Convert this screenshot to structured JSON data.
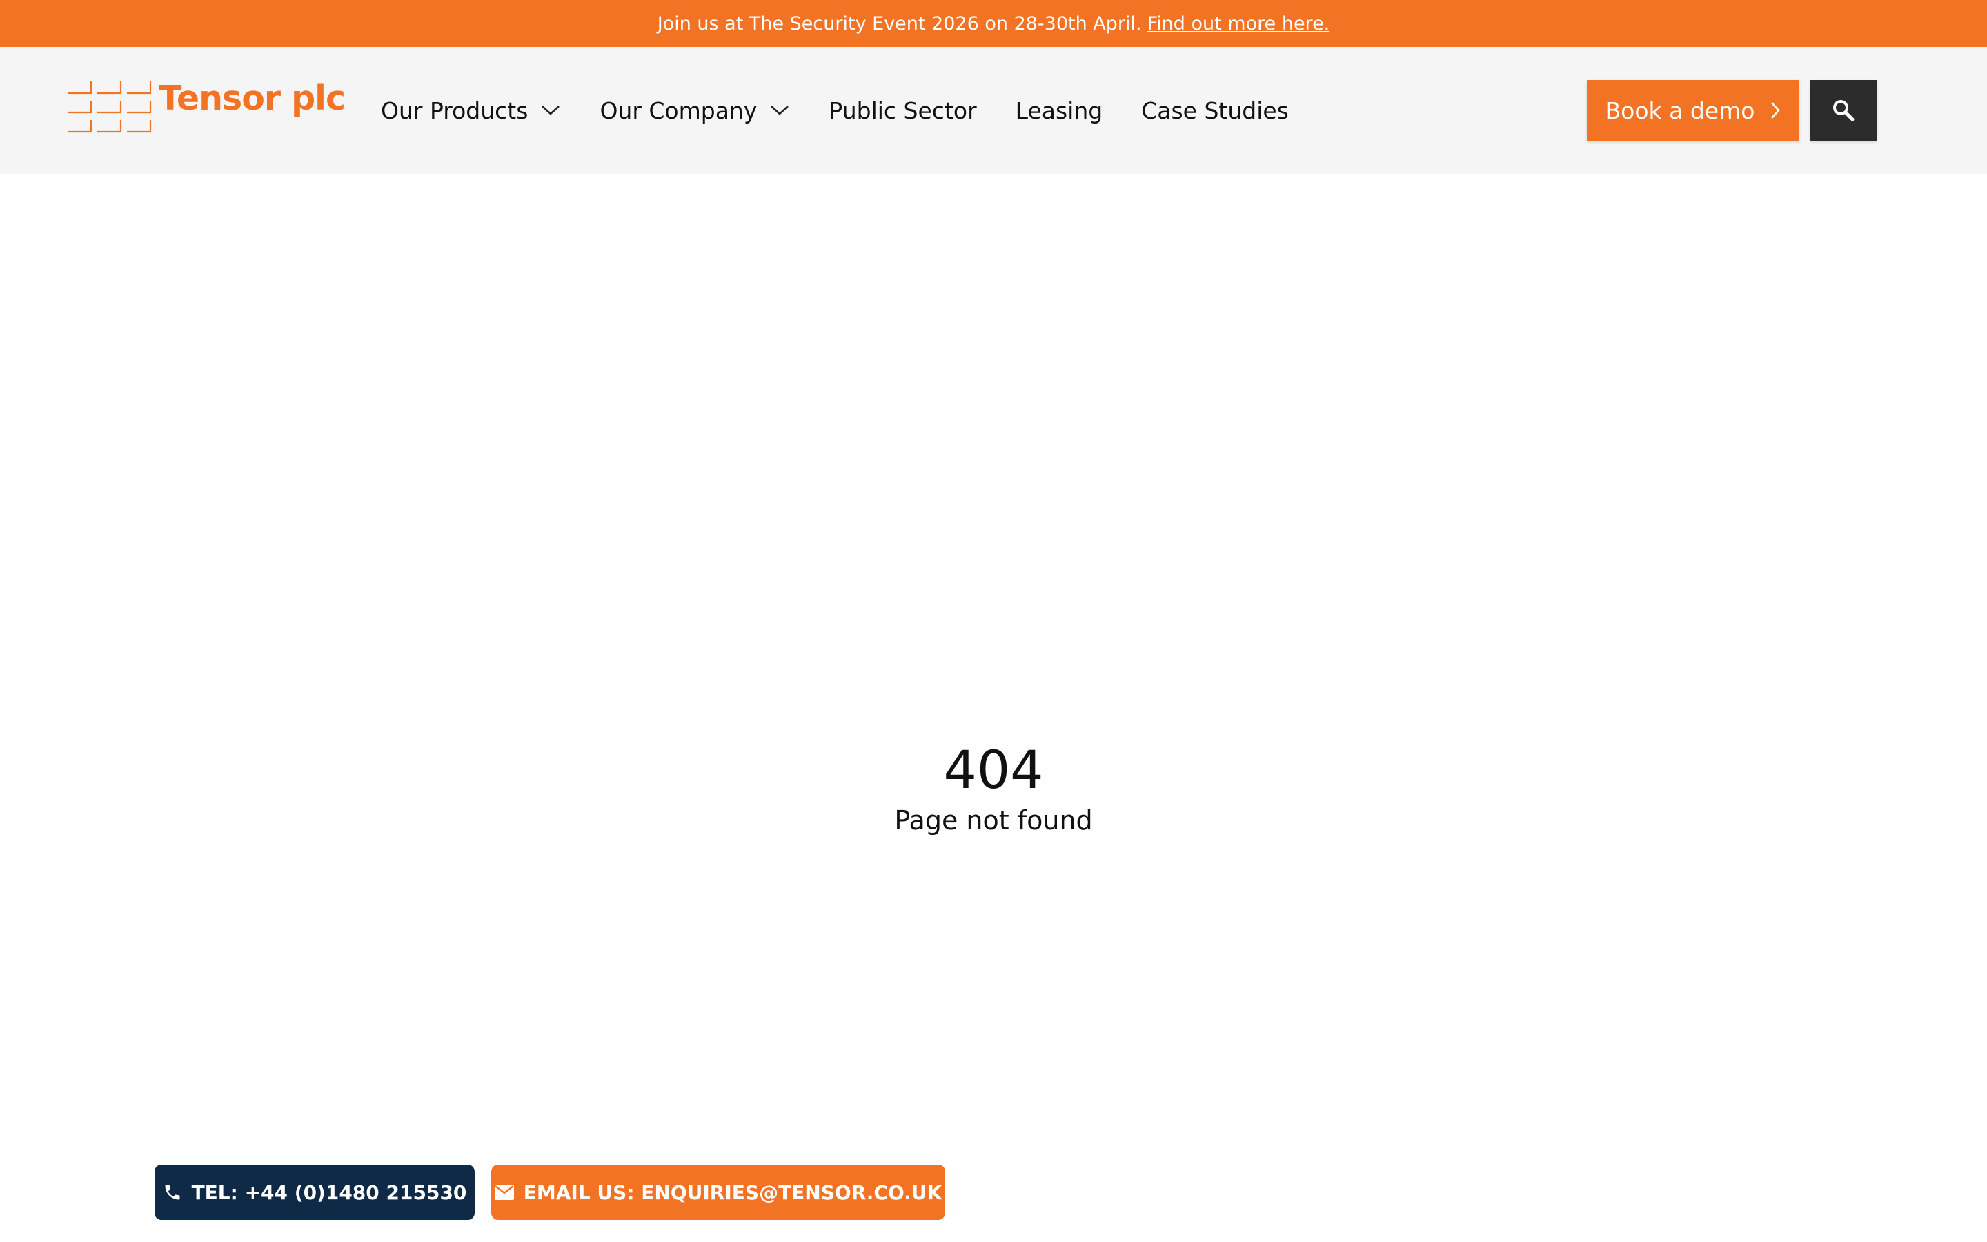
{
  "announcement": {
    "text": "Join us at The Security Event 2026 on 28-30th April.",
    "link_label": "Find out more here."
  },
  "header": {
    "logo_text": "Tensor plc",
    "nav": [
      {
        "label": "Our Products",
        "has_dropdown": true
      },
      {
        "label": "Our Company",
        "has_dropdown": true
      },
      {
        "label": "Public Sector",
        "has_dropdown": false
      },
      {
        "label": "Leasing",
        "has_dropdown": false
      },
      {
        "label": "Case Studies",
        "has_dropdown": false
      }
    ],
    "cta_label": "Book a demo",
    "search_icon": "search-icon"
  },
  "main": {
    "code": "404",
    "message": "Page not found"
  },
  "contact": {
    "tel_label": "TEL: +44 (0)1480 215530",
    "email_label": "EMAIL US: ENQUIRIES@TENSOR.CO.UK"
  },
  "colors": {
    "brand_orange": "#f37324",
    "header_bg": "#f5f5f5",
    "navy": "#0f2a47",
    "search_bg": "#2c2c2c"
  }
}
